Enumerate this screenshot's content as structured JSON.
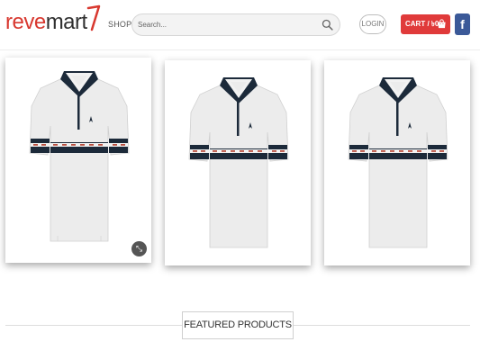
{
  "header": {
    "logo": {
      "part1": "reve",
      "part2": "mart"
    },
    "shop_label": "SHOP",
    "search": {
      "placeholder": "Search...",
      "value": ""
    },
    "login_label": "LOGIN",
    "cart_label": "CART / ৳0",
    "facebook_label": "f"
  },
  "products": [
    {
      "image": "polo-shirt",
      "zoom_symbol": "⤡"
    },
    {
      "image": "polo-shirt"
    },
    {
      "image": "polo-shirt"
    }
  ],
  "featured": {
    "title": "FEATURED PRODUCTS"
  },
  "colors": {
    "brand_red": "#d8382f",
    "cart_red": "#e03a3a",
    "facebook_blue": "#3b5998",
    "shirt_body": "#ececec",
    "shirt_navy": "#1c2a3a"
  }
}
